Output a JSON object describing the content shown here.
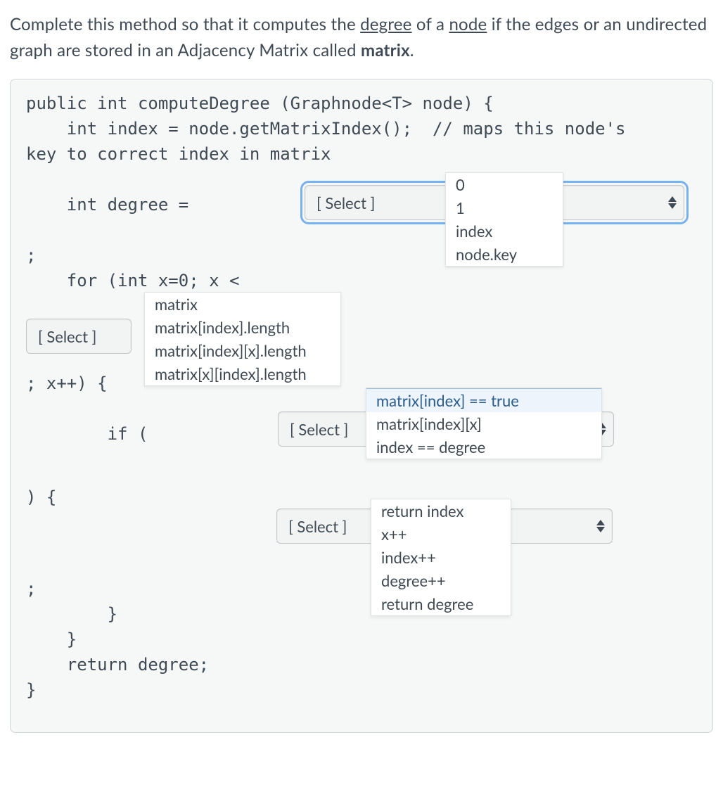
{
  "question": {
    "part1": "Complete this method so that it computes the ",
    "ul1": "degree",
    "part2": " of a ",
    "ul2": "node",
    "part3": " if the edges or an undirected graph are stored in an Adjacency Matrix called ",
    "bold": "matrix",
    "part4": "."
  },
  "code": {
    "l1": "public int computeDegree (Graphnode<T> node) {",
    "l2": "    int index = node.getMatrixIndex();  // maps this node's",
    "l3": "key to correct index in matrix",
    "l4": "    int degree = ",
    "l5": ";",
    "l6": "    for (int x=0; x < ",
    "l7": "; x++) {",
    "l8": "        if ( ",
    "l9": ") {",
    "l10": ";",
    "l11": "        }",
    "l12": "    }",
    "l13": "    return degree;",
    "l14": "}"
  },
  "selects": {
    "s1": {
      "label": "[ Select ]",
      "options": [
        "0",
        "1",
        "index",
        "node.key"
      ]
    },
    "s2": {
      "label": "[ Select ]",
      "options": [
        "matrix",
        "matrix[index].length",
        "matrix[index][x].length",
        "matrix[x][index].length"
      ]
    },
    "s3": {
      "label": "[ Select ]",
      "options": [
        "matrix[index] == true",
        "matrix[index][x]",
        "index == degree"
      ]
    },
    "s4": {
      "label": "[ Select ]",
      "options": [
        "return index",
        "x++",
        "index++",
        "degree++",
        "return degree"
      ]
    }
  }
}
